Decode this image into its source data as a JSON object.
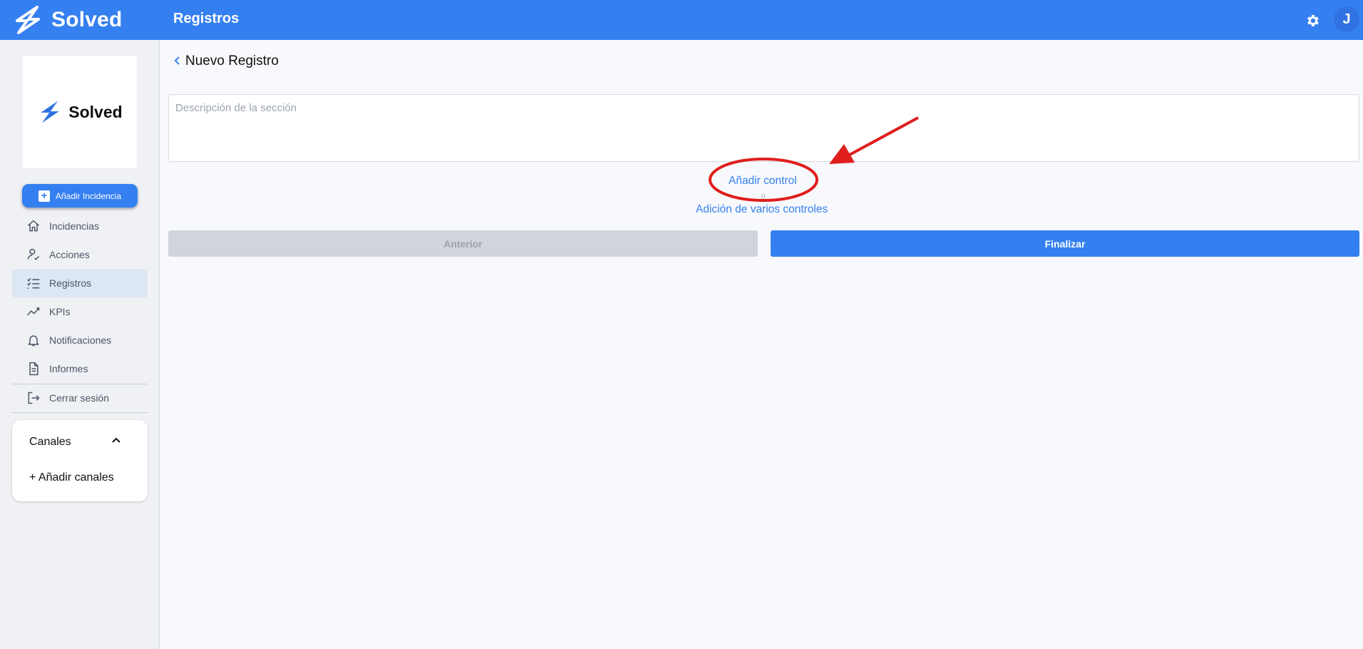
{
  "header": {
    "brand": "Solved",
    "title": "Registros",
    "avatar_initial": "J",
    "settings_icon": "gear-icon"
  },
  "sidebar": {
    "logo_text": "Solved",
    "add_button": "Añadir Incidencia",
    "items": [
      {
        "label": "Incidencias",
        "icon": "home-icon"
      },
      {
        "label": "Acciones",
        "icon": "user-check-icon"
      },
      {
        "label": "Registros",
        "icon": "checklist-icon",
        "active": true
      },
      {
        "label": "KPIs",
        "icon": "trend-icon"
      },
      {
        "label": "Notificaciones",
        "icon": "bell-icon"
      },
      {
        "label": "Informes",
        "icon": "document-icon"
      }
    ],
    "logout": {
      "label": "Cerrar sesión",
      "icon": "logout-icon"
    },
    "channels": {
      "title": "Canales",
      "add_label": "+ Añadir canales"
    }
  },
  "main": {
    "title": "Nuevo Registro",
    "description_placeholder": "Descripción de la sección",
    "add_control": "Añadir control",
    "or_text": "o",
    "add_multiple": "Adición de varios controles",
    "prev_button": "Anterior",
    "finish_button": "Finalizar"
  },
  "colors": {
    "primary": "#3580f0",
    "annotation": "#e01e1e"
  }
}
